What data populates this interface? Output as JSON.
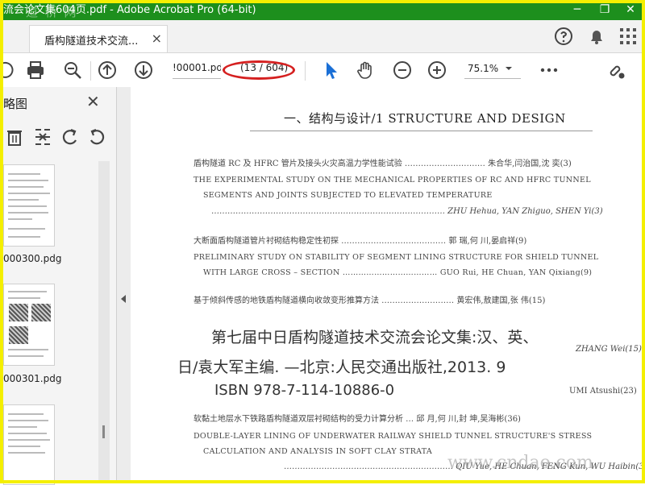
{
  "window": {
    "title": "流会论文集604页.pdf - Adobe Acrobat Pro (64-bit)",
    "watermark": "道 桥 网",
    "controls": [
      "─",
      "❐",
      "✕"
    ]
  },
  "tabs": {
    "active_label": "盾构隧道技术交流...",
    "close_label": "×"
  },
  "toolbar": {
    "page_value": "!00001.pdg",
    "page_count": "(13 / 604)",
    "zoom": "75.1%"
  },
  "sidebar": {
    "title": "略图",
    "close_label": "✕",
    "thumbnails": [
      {
        "label": ""
      },
      {
        "label": "000300.pdg"
      },
      {
        "label": "000301.pdg"
      }
    ]
  },
  "document": {
    "heading": "一、结构与设计/1  STRUCTURE AND DESIGN",
    "entries": [
      {
        "cn": "盾构隧道 RC 及 HFRC 管片及接头火灾高温力学性能试验 ………………………… 朱合华,闫治国,沈  奕(3)"
      },
      {
        "en": "THE EXPERIMENTAL STUDY ON THE MECHANICAL PROPERTIES OF RC AND HFRC TUNNEL"
      },
      {
        "en": "SEGMENTS AND JOINTS SUBJECTED TO ELEVATED TEMPERATURE"
      },
      {
        "au": "…………………………………………………………………………… ZHU Hehua, YAN Zhiguo, SHEN Yi(3)"
      },
      {
        "cn": "大断面盾构隧道管片衬砌结构稳定性初探 ………………………………… 郭  瑞,何  川,晏启祥(9)"
      },
      {
        "en": "PRELIMINARY STUDY ON STABILITY OF SEGMENT LINING STRUCTURE FOR SHIELD TUNNEL"
      },
      {
        "en": "WITH LARGE CROSS – SECTION ……………………………… GUO Rui, HE Chuan, YAN Qixiang(9)"
      },
      {
        "cn": "基于倾斜传感的地铁盾构隧道横向收敛变形推算方法 ……………………… 黄宏伟,敖建国,张  伟(15)"
      }
    ],
    "overlay_line1": "第七届中日盾构隧道技术交流会论文集:汉、英、",
    "overlay_author1": "ZHANG Wei(15)",
    "overlay_line2": "日/袁大军主编. —北京:人民交通出版社,2013. 9",
    "overlay_line3": "ISBN  978-7-114-10886-0",
    "overlay_author2": "UMI Atsushi(23)",
    "entries2": [
      {
        "cn": "软黏土地层水下铁路盾构隧道双层衬砌结构的受力计算分析 … 邱  月,何  川,封  坤,吴海彬(36)"
      },
      {
        "en": "DOUBLE-LAYER LINING OF UNDERWATER RAILWAY SHIELD TUNNEL STRUCTURE'S STRESS"
      },
      {
        "en": "CALCULATION AND ANALYSIS IN SOFT CLAY STRATA"
      },
      {
        "au": "……………………………………………………… QIU Yue, HE Chuan, FENG Kun, WU Haibin(36)"
      }
    ],
    "site_watermark": "www.cndao.com"
  }
}
